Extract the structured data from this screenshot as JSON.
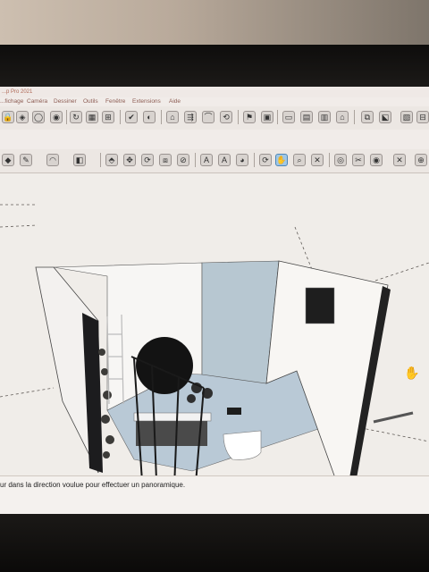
{
  "window": {
    "title": "...p Pro 2021"
  },
  "menu": {
    "items": [
      "...fichage",
      "Caméra",
      "Dessiner",
      "Outils",
      "Fenêtre",
      "Extensions",
      "Aide"
    ]
  },
  "toolbar_top": {
    "icons": [
      "lock-icon",
      "paint-icon",
      "circle-icon",
      "camera-icon",
      "rotate-icon",
      "box-icon",
      "section-icon",
      "view-icon",
      "style-icon",
      "material-icon",
      "arrow-icon",
      "warehouse-icon",
      "extension-icon",
      "flag-icon",
      "refresh-icon",
      "scene-icon",
      "layout-icon",
      "window-icon",
      "tray-icon",
      "component-icon",
      "export-icon",
      "group-icon",
      "grid-icon"
    ]
  },
  "toolbar_bottom": {
    "icons": [
      "eraser-icon",
      "pencil-icon",
      "arc-icon",
      "rectangle-icon",
      "push-pull-icon",
      "move-icon",
      "rotate-icon",
      "offset-icon",
      "tape-measure-icon",
      "text-icon",
      "paint-bucket-icon",
      "orbit-icon",
      "pan-icon",
      "zoom-icon",
      "zoom-extents-icon",
      "walk-icon",
      "look-around-icon",
      "position-camera-icon",
      "sandbox-icon",
      "add-location-icon"
    ],
    "active_icon": "pan-icon"
  },
  "status": {
    "hint": "ur dans la direction voulue pour effectuer un panoramique."
  },
  "colors": {
    "accent": "#4d86b8",
    "viewport_bg": "#f0ede9",
    "floor": "#b9c9d6",
    "wall_blue": "#b7c7d1"
  }
}
